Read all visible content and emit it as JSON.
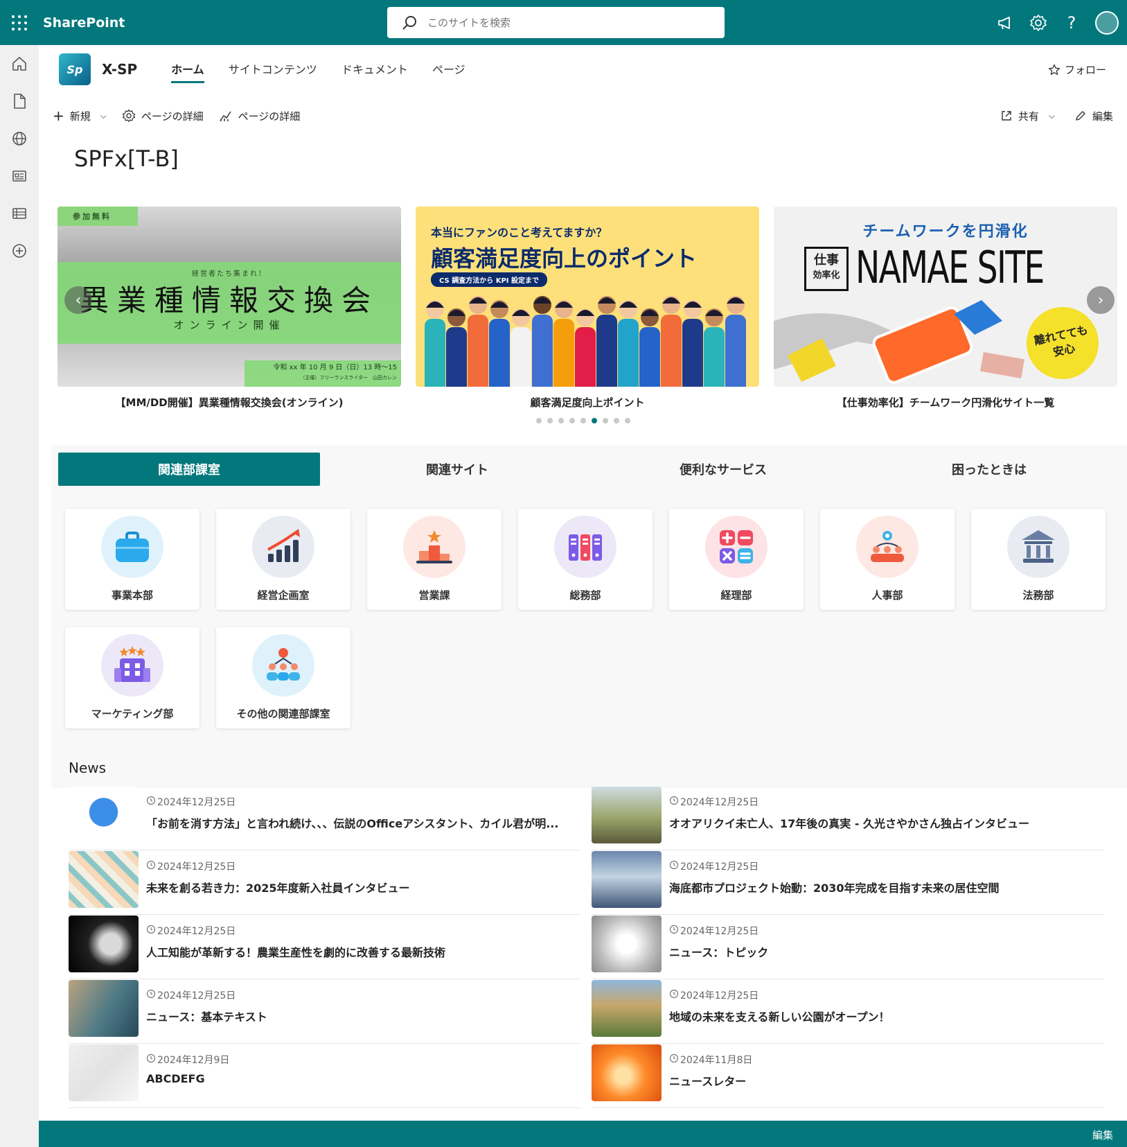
{
  "suite": {
    "brand": "SharePoint",
    "search_placeholder": "このサイトを検索"
  },
  "site": {
    "logo_text": "Sp",
    "name": "X-SP",
    "nav": [
      "ホーム",
      "サイトコンテンツ",
      "ドキュメント",
      "ページ"
    ],
    "follow": "フォロー"
  },
  "command_bar": {
    "new": "新規",
    "page_details": "ページの詳細",
    "page_analytics": "ページの詳細",
    "share": "共有",
    "edit": "編集"
  },
  "page_title": "SPFx[T-B]",
  "hero": {
    "slides": [
      {
        "caption": "【MM/DD開催】異業種情報交換会(オンライン)",
        "tag": "参加無料",
        "small": "経営者たち集まれ！",
        "title": "異業種情報交換会",
        "subtitle": "オンライン開催",
        "footer_line1": "令和 xx 年 10 月 9 日（日）13 時～15",
        "footer_line2": "（主催）フリーランスライター　山田カレン"
      },
      {
        "caption": "顧客満足度向上ポイント",
        "question": "本当にファンのこと考えてますか？",
        "title": "顧客満足度向上のポイント",
        "pill": "CS 調査方法から KPI 設定まで"
      },
      {
        "caption": "【仕事効率化】チームワーク円滑化サイト一覧",
        "title": "チームワークを円滑化",
        "box_line1": "仕事",
        "box_line2": "効率化",
        "name": "NAMAE SITE",
        "badge_line1": "離れてても",
        "badge_line2": "安心"
      }
    ],
    "dots_total": 9,
    "dot_active": 5
  },
  "tabs": [
    "関連部課室",
    "関連サイト",
    "便利なサービス",
    "困ったときは"
  ],
  "tiles": [
    {
      "label": "事業本部",
      "icon": "briefcase-icon"
    },
    {
      "label": "経営企画室",
      "icon": "growth-chart-icon"
    },
    {
      "label": "営業課",
      "icon": "podium-icon"
    },
    {
      "label": "総務部",
      "icon": "binders-icon"
    },
    {
      "label": "経理部",
      "icon": "calculator-icon"
    },
    {
      "label": "人事部",
      "icon": "people-gear-icon"
    },
    {
      "label": "法務部",
      "icon": "courthouse-icon"
    },
    {
      "label": "マーケティング部",
      "icon": "building-stars-icon"
    },
    {
      "label": "その他の関連部課室",
      "icon": "org-chart-icon"
    }
  ],
  "news": {
    "title": "News",
    "items": [
      {
        "date": "2024年12月25日",
        "headline": "「お前を消す方法」と言われ続け、、、伝説のOfficeアシスタント、カイル君が明..."
      },
      {
        "date": "2024年12月25日",
        "headline": "オオアリクイ未亡人、17年後の真実 - 久光さやかさん独占インタビュー"
      },
      {
        "date": "2024年12月25日",
        "headline": "未来を創る若き力：2025年度新入社員インタビュー"
      },
      {
        "date": "2024年12月25日",
        "headline": "海底都市プロジェクト始動：2030年完成を目指す未来の居住空間"
      },
      {
        "date": "2024年12月25日",
        "headline": "人工知能が革新する！農業生産性を劇的に改善する最新技術"
      },
      {
        "date": "2024年12月25日",
        "headline": "ニュース：トピック"
      },
      {
        "date": "2024年12月25日",
        "headline": "ニュース：基本テキスト"
      },
      {
        "date": "2024年12月25日",
        "headline": "地域の未来を支える新しい公園がオープン！"
      },
      {
        "date": "2024年12月9日",
        "headline": "ABCDEFG"
      },
      {
        "date": "2024年11月8日",
        "headline": "ニュースレター"
      }
    ]
  },
  "footer": {
    "edit": "編集"
  },
  "colors": {
    "accent": "#03787c"
  }
}
